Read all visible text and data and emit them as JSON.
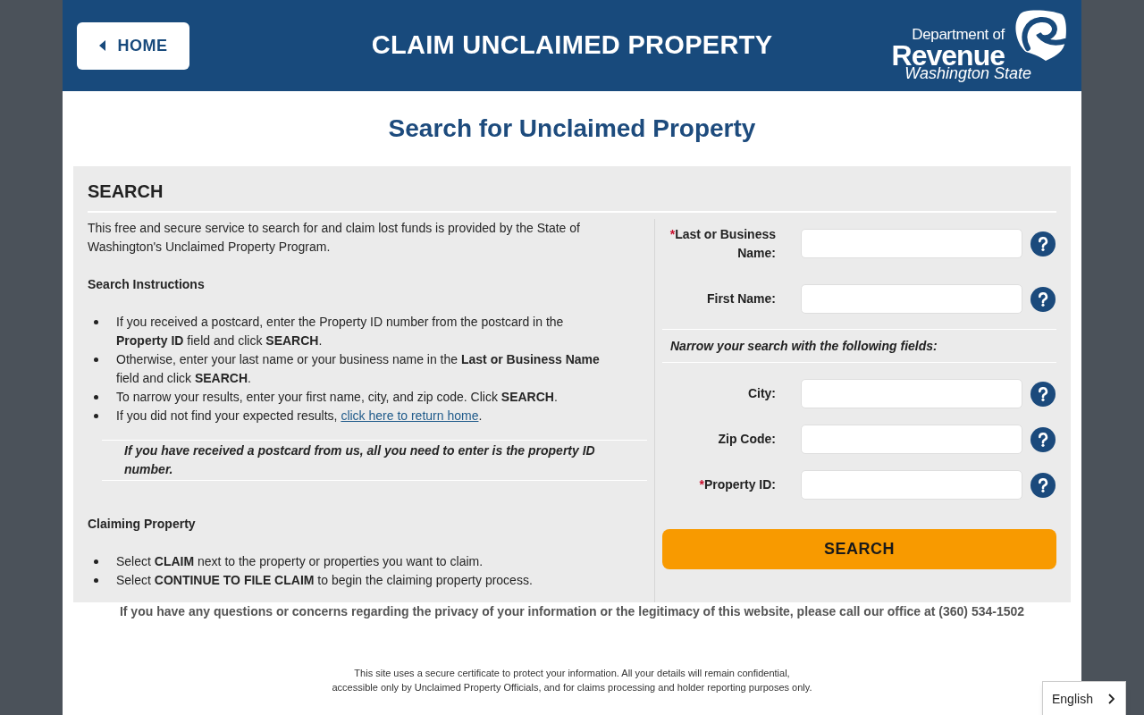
{
  "header": {
    "home_button": "HOME",
    "title": "CLAIM UNCLAIMED PROPERTY",
    "logo": {
      "line_1": "Department of",
      "line_2": "Revenue",
      "line_3": "Washington State"
    }
  },
  "page_heading": "Search for Unclaimed Property",
  "search_section": {
    "heading": "SEARCH",
    "intro": "This free and secure service to search for and claim lost funds is provided by the State of Washington's Unclaimed Property Program.",
    "instructions_heading": "Search Instructions",
    "instructions": [
      {
        "text": "If you received a postcard, enter the Property ID number from the postcard in the **Property ID** field and click **SEARCH**."
      },
      {
        "text": "Otherwise, enter your last name or your business name in the **Last or Business Name** field and click **SEARCH**."
      },
      {
        "text": "To narrow your results, enter your first name, city, and zip code. Click **SEARCH**."
      },
      {
        "text": "If you did not find your expected results, ",
        "link": "click here to return home",
        "text_after": "."
      }
    ],
    "postcard_note": "If you have received a postcard from us, all you need to enter is the property ID number.",
    "claiming_heading": "Claiming Property",
    "claiming_steps": [
      "Select **CLAIM** next to the property or properties you want to claim.",
      "Select **CONTINUE TO FILE CLAIM** to begin the claiming property process."
    ],
    "form": {
      "name_fields": [
        {
          "label": "Last or Business Name:",
          "required_mark": "*"
        },
        {
          "label": "First Name:"
        }
      ],
      "narrow_hint": "Narrow your search with the following fields:",
      "narrow_fields": [
        {
          "label": "City:"
        },
        {
          "label": "Zip Code:"
        },
        {
          "label": "Property ID:",
          "required_mark": "*"
        }
      ],
      "search_button": "SEARCH"
    }
  },
  "contact_note": "If you have any questions or concerns regarding the privacy of your information or the legitimacy of this website, please call our office at (360) 534-1502",
  "footer_notice": [
    "This site uses a secure certificate to protect your information. All your details will remain confidential,",
    "accessible only by Unclaimed Property Officials, and for claims processing and holder reporting purposes only."
  ],
  "language_selector": {
    "value": "English"
  }
}
